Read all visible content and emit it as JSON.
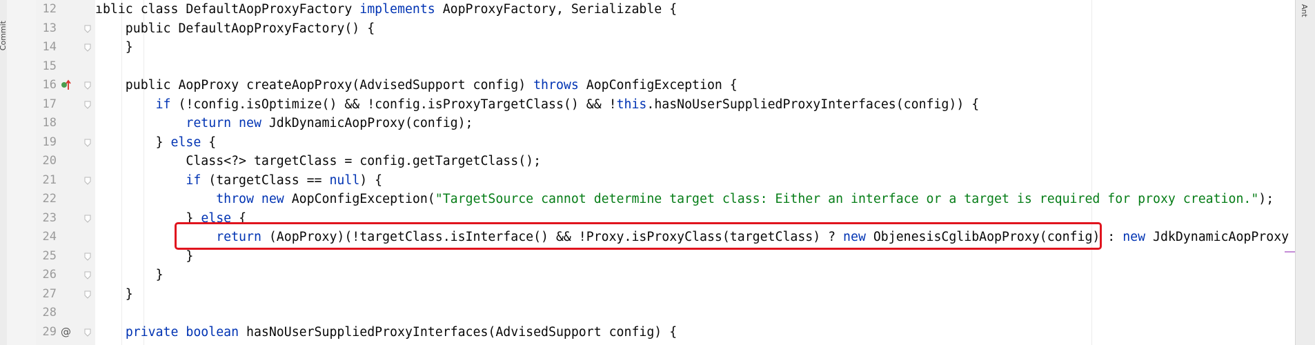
{
  "left_tool_window": {
    "label": "Commit"
  },
  "right_tool_window": {
    "label": "Ant"
  },
  "editor": {
    "lines": [
      {
        "no": "12",
        "segments": [
          {
            "t": "ıblic class DefaultAopProxyFactory "
          },
          {
            "t": "implements",
            "c": "kw"
          },
          {
            "t": " AopProxyFactory, Serializable {"
          }
        ]
      },
      {
        "no": "13",
        "segments": [
          {
            "t": "    public DefaultAopProxyFactory() {"
          }
        ]
      },
      {
        "no": "14",
        "segments": [
          {
            "t": "    }"
          }
        ]
      },
      {
        "no": "15",
        "segments": [
          {
            "t": ""
          }
        ]
      },
      {
        "no": "16",
        "segments": [
          {
            "t": "    public AopProxy createAopProxy(AdvisedSupport config) "
          },
          {
            "t": "throws",
            "c": "kw"
          },
          {
            "t": " AopConfigException {"
          }
        ]
      },
      {
        "no": "17",
        "segments": [
          {
            "t": "        "
          },
          {
            "t": "if",
            "c": "kw"
          },
          {
            "t": " (!config.isOptimize() && !config.isProxyTargetClass() && !"
          },
          {
            "t": "this",
            "c": "kw"
          },
          {
            "t": ".hasNoUserSuppliedProxyInterfaces(config)) {"
          }
        ]
      },
      {
        "no": "18",
        "segments": [
          {
            "t": "            "
          },
          {
            "t": "return new",
            "c": "kw"
          },
          {
            "t": " JdkDynamicAopProxy(config);"
          }
        ]
      },
      {
        "no": "19",
        "segments": [
          {
            "t": "        } "
          },
          {
            "t": "else",
            "c": "kw"
          },
          {
            "t": " {"
          }
        ]
      },
      {
        "no": "20",
        "segments": [
          {
            "t": "            Class<?> targetClass = config.getTargetClass();"
          }
        ]
      },
      {
        "no": "21",
        "segments": [
          {
            "t": "            "
          },
          {
            "t": "if",
            "c": "kw"
          },
          {
            "t": " (targetClass == "
          },
          {
            "t": "null",
            "c": "kw"
          },
          {
            "t": ") {"
          }
        ]
      },
      {
        "no": "22",
        "segments": [
          {
            "t": "                "
          },
          {
            "t": "throw new",
            "c": "kw"
          },
          {
            "t": " AopConfigException("
          },
          {
            "t": "\"TargetSource cannot determine target class: Either an interface or a target is required for proxy creation.\"",
            "c": "str"
          },
          {
            "t": ");"
          }
        ]
      },
      {
        "no": "23",
        "segments": [
          {
            "t": "            } "
          },
          {
            "t": "else",
            "c": "kw"
          },
          {
            "t": " {"
          }
        ]
      },
      {
        "no": "24",
        "segments": [
          {
            "t": "                "
          },
          {
            "t": "return",
            "c": "kw"
          },
          {
            "t": " (AopProxy)(!targetClass.isInterface() && !Proxy.isProxyClass(targetClass) ? "
          },
          {
            "t": "new",
            "c": "kw"
          },
          {
            "t": " ObjenesisCglibAopProxy(config) : "
          },
          {
            "t": "new",
            "c": "kw"
          },
          {
            "t": " JdkDynamicAopProxy(co"
          }
        ]
      },
      {
        "no": "25",
        "segments": [
          {
            "t": "            }"
          }
        ]
      },
      {
        "no": "26",
        "segments": [
          {
            "t": "        }"
          }
        ]
      },
      {
        "no": "27",
        "segments": [
          {
            "t": "    }"
          }
        ]
      },
      {
        "no": "28",
        "segments": [
          {
            "t": ""
          }
        ]
      },
      {
        "no": "29",
        "segments": [
          {
            "t": "    "
          },
          {
            "t": "private boolean",
            "c": "kw"
          },
          {
            "t": " hasNoUserSuppliedProxyInterfaces(AdvisedSupport config) {"
          }
        ]
      }
    ]
  },
  "gutter_markers": [
    {
      "line": "16",
      "icon": "implements-method-icon"
    },
    {
      "line": "29",
      "icon": "annotation-icon"
    }
  ],
  "colors": {
    "keyword": "#0033b3",
    "string": "#067d17",
    "highlight": "#e0141e"
  }
}
